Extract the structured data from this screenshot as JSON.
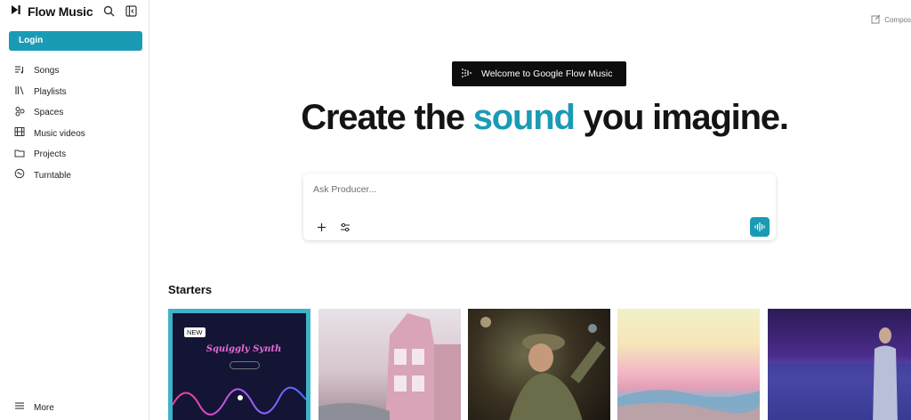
{
  "brand": {
    "name": "Flow Music"
  },
  "sidebar": {
    "login_label": "Login",
    "items": [
      {
        "label": "Songs",
        "icon": "songs-icon"
      },
      {
        "label": "Playlists",
        "icon": "playlists-icon"
      },
      {
        "label": "Spaces",
        "icon": "spaces-icon"
      },
      {
        "label": "Music videos",
        "icon": "music-videos-icon"
      },
      {
        "label": "Projects",
        "icon": "folder-icon"
      },
      {
        "label": "Turntable",
        "icon": "turntable-icon"
      }
    ],
    "more_label": "More"
  },
  "header": {
    "compose_label": "Compos"
  },
  "hero": {
    "badge_text": "Welcome to Google Flow Music",
    "title_before": "Create the ",
    "title_accent": "sound",
    "title_after": " you imagine."
  },
  "prompt": {
    "placeholder": "Ask Producer..."
  },
  "starters": {
    "title": "Starters",
    "cards": [
      {
        "badge": "NEW",
        "title": "Squiggly Synth"
      },
      {},
      {},
      {},
      {}
    ]
  },
  "colors": {
    "accent": "#1a9bb5",
    "dark": "#0d0d0d"
  }
}
